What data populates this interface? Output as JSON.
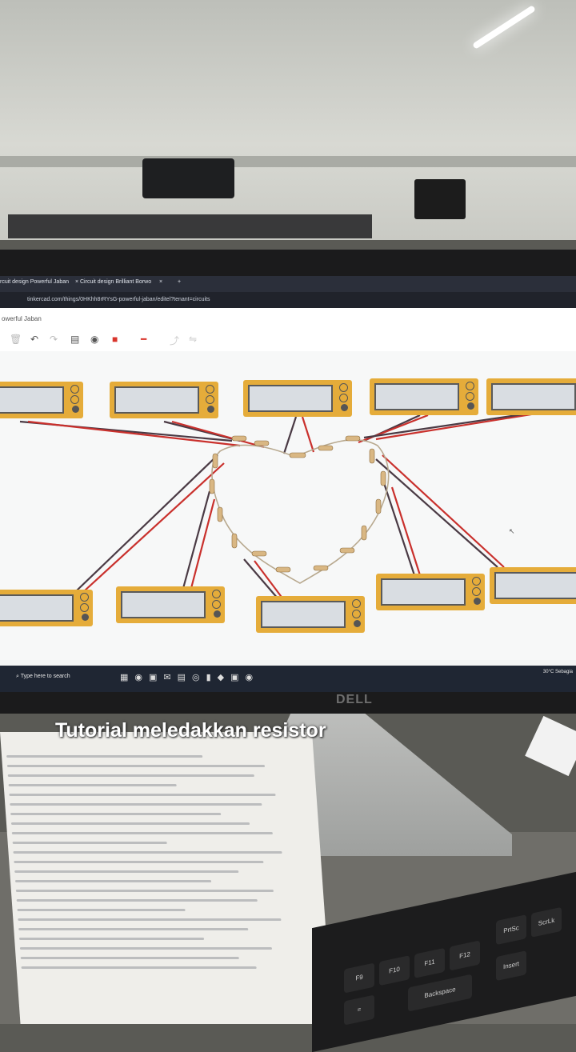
{
  "browser": {
    "tabs": [
      {
        "label": "rcuit design Powerful Jaban"
      },
      {
        "label": "Circuit design Brilliant Borwo"
      }
    ],
    "tab_close": "×",
    "new_tab": "+",
    "address": "tinkercad.com/things/0HKhh8rRYsG-powerful-jaban/editel?tenant=circuits"
  },
  "app": {
    "title": "owerful Jaban",
    "canvas_summary": "10 multimeters wired to a heart-shaped chain of resistors"
  },
  "taskbar": {
    "search_placeholder": "Type here to search",
    "tray_text": "30°C  Sebagia"
  },
  "monitor": {
    "brand": "DELL"
  },
  "caption": {
    "text": "Tutorial meledakkan resistor"
  },
  "colors": {
    "meter": "#e5ac3a",
    "wire_red": "#c9302c",
    "wire_dark": "#4a3a44",
    "taskbar": "#1f2633"
  }
}
